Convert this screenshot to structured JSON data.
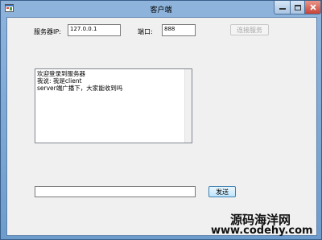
{
  "window": {
    "title": "客户端"
  },
  "server": {
    "ip_label": "服务器IP:",
    "ip_value": "127.0.0.1",
    "port_label": "端口:",
    "port_value": "888",
    "connect_button": "连接服务"
  },
  "messages": [
    "欢迎登录到服务器",
    "我说: 我是client",
    "server端广播下，大家能收到吗"
  ],
  "composer": {
    "input_value": "",
    "send_button": "发送"
  },
  "watermark": {
    "name": "源码海洋网",
    "url": "www.codehy.com"
  },
  "colors": {
    "titlebar": "#8fb4dc",
    "close_button": "#c7443a",
    "form_background": "#f0f0f0"
  }
}
